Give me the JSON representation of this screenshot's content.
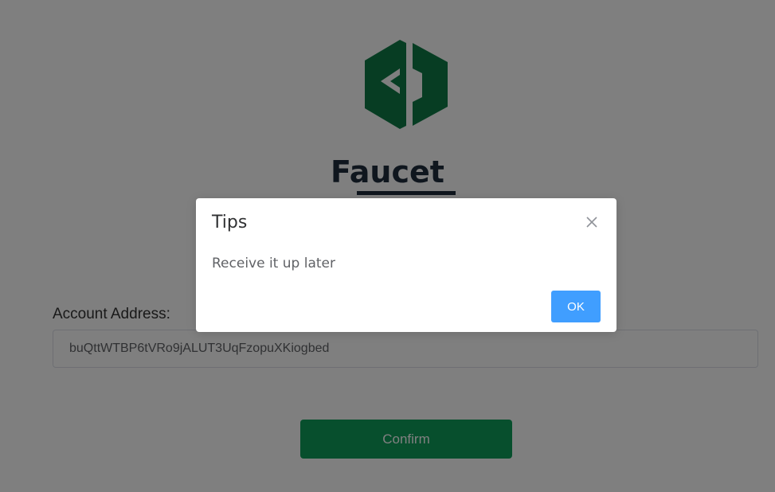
{
  "page": {
    "title": "Faucet",
    "logo_icon": "faucet-logo-icon",
    "accent_color": "#0e9f5b"
  },
  "form": {
    "address_label": "Account Address:",
    "address_value": "buQttWTBP6tVRo9jALUT3UqFzopuXKiogbed",
    "confirm_label": "Confirm"
  },
  "dialog": {
    "title": "Tips",
    "message": "Receive it up later",
    "ok_label": "OK",
    "close_icon": "close-icon",
    "ok_color": "#409eff"
  }
}
